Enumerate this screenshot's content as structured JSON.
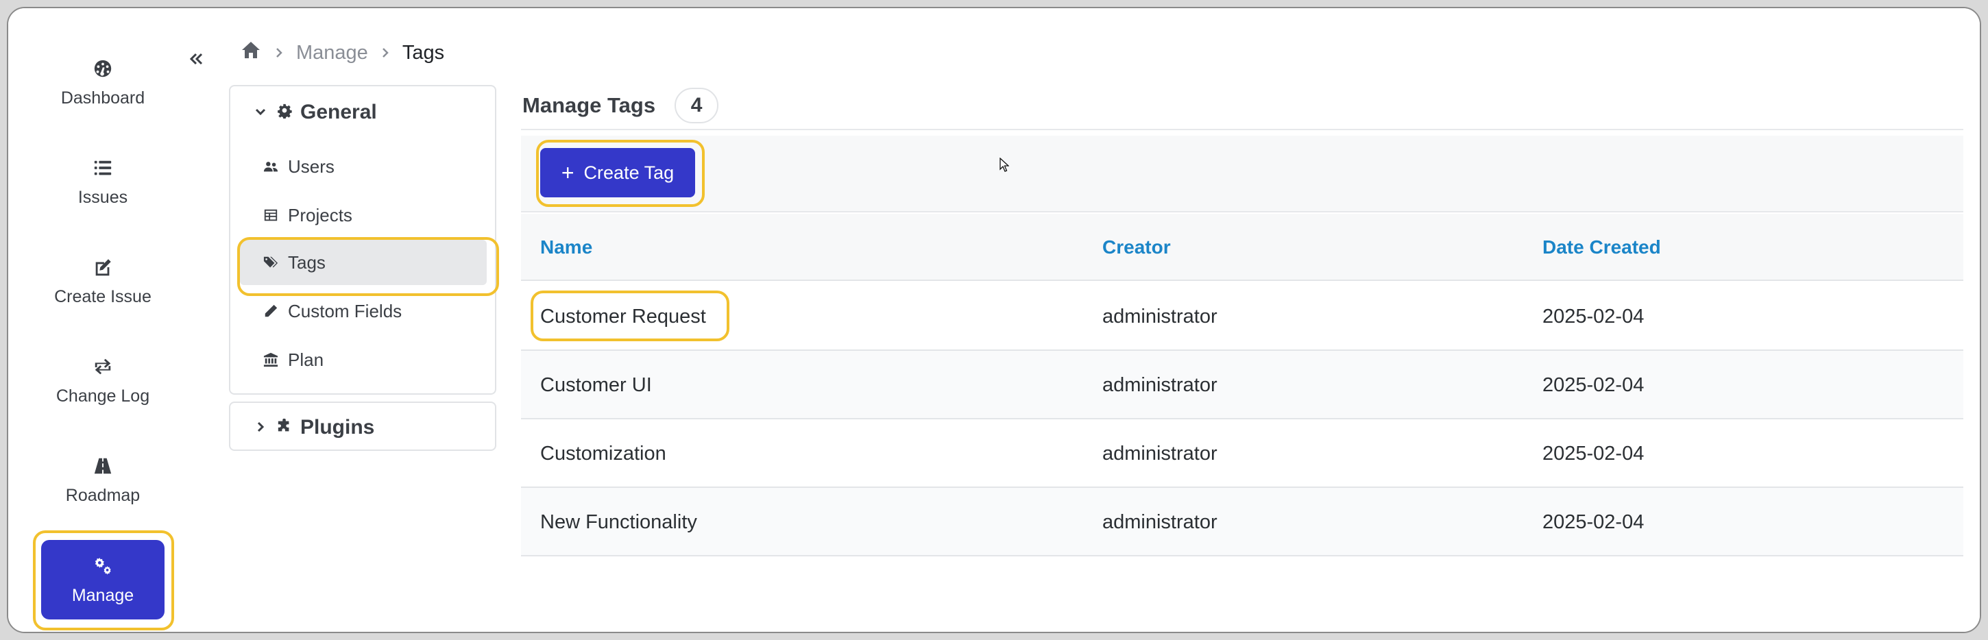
{
  "nav": {
    "items": [
      {
        "label": "Dashboard",
        "icon": "dashboard-icon"
      },
      {
        "label": "Issues",
        "icon": "list-icon"
      },
      {
        "label": "Create Issue",
        "icon": "edit-icon"
      },
      {
        "label": "Change Log",
        "icon": "change-log-icon"
      },
      {
        "label": "Roadmap",
        "icon": "roadmap-icon"
      },
      {
        "label": "Manage",
        "icon": "gears-icon",
        "active": true
      }
    ]
  },
  "breadcrumb": {
    "items": [
      "Manage",
      "Tags"
    ]
  },
  "subnav": {
    "general": {
      "label": "General",
      "items": [
        {
          "label": "Users",
          "icon": "users-icon"
        },
        {
          "label": "Projects",
          "icon": "table-icon"
        },
        {
          "label": "Tags",
          "icon": "tags-icon",
          "active": true
        },
        {
          "label": "Custom Fields",
          "icon": "pencil-icon"
        },
        {
          "label": "Plan",
          "icon": "bank-icon"
        }
      ]
    },
    "plugins": {
      "label": "Plugins"
    }
  },
  "main": {
    "title": "Manage Tags",
    "count": "4",
    "create_label": "Create Tag",
    "table": {
      "headers": [
        "Name",
        "Creator",
        "Date Created"
      ],
      "rows": [
        [
          "Customer Request",
          "administrator",
          "2025-02-04"
        ],
        [
          "Customer UI",
          "administrator",
          "2025-02-04"
        ],
        [
          "Customization",
          "administrator",
          "2025-02-04"
        ],
        [
          "New Functionality",
          "administrator",
          "2025-02-04"
        ]
      ]
    }
  },
  "colors": {
    "accent": "#3438c9",
    "highlight": "#f2c12e",
    "header_link": "#1b85c8"
  }
}
